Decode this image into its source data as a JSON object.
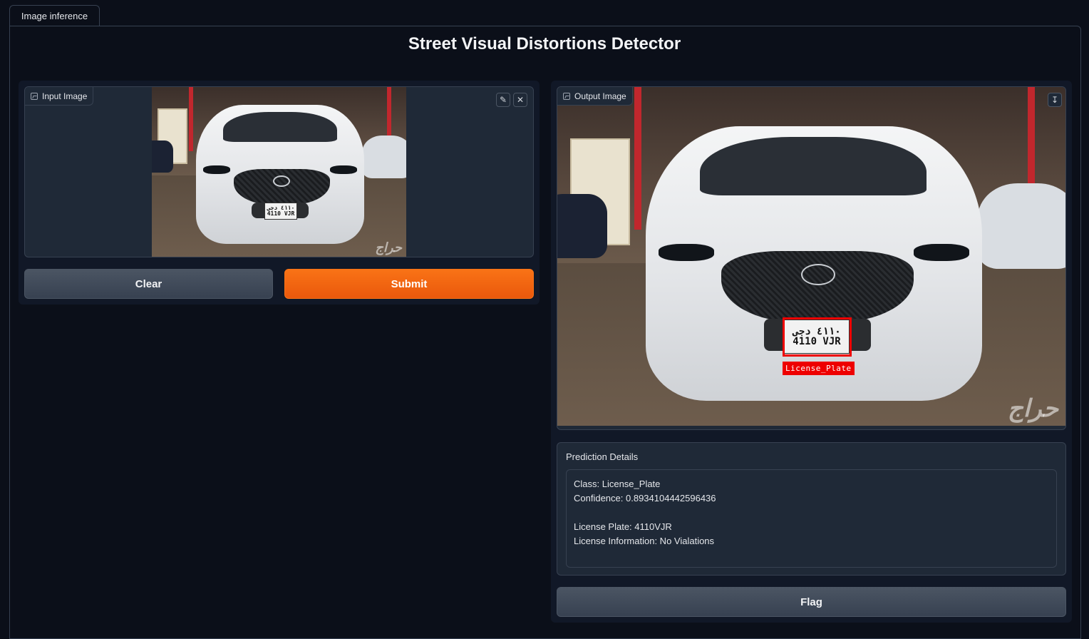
{
  "tabs": [
    {
      "label": "Image inference"
    }
  ],
  "page": {
    "title": "Street Visual Distortions Detector"
  },
  "input_panel": {
    "label": "Input Image",
    "edit_icon": "pencil-icon",
    "close_icon": "close-icon",
    "plate_top": "٤١١٠ دجى",
    "plate_bottom": "4110 VJR",
    "watermark": "حراج"
  },
  "buttons": {
    "clear": "Clear",
    "submit": "Submit",
    "flag": "Flag"
  },
  "output_panel": {
    "label": "Output Image",
    "download_icon": "download-icon",
    "plate_top": "٤١١٠ دجى",
    "plate_bottom": "4110 VJR",
    "detection_label": "License_Plate",
    "watermark": "حراج"
  },
  "prediction": {
    "label": "Prediction Details",
    "text": "Class: License_Plate\nConfidence: 0.8934104442596436\n\nLicense Plate: 4110VJR\nLicense Information: No Vialations"
  },
  "colors": {
    "accent": "#f97316",
    "background": "#0b0f19",
    "panel": "#1f2937",
    "bbox": "#e00000"
  }
}
